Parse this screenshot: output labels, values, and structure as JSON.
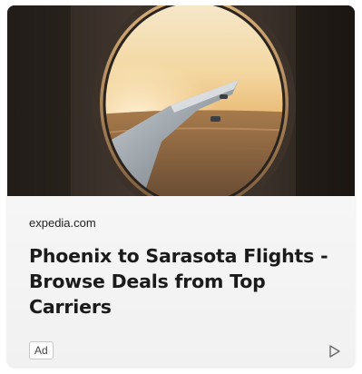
{
  "ad": {
    "image_alt": "airplane wing seen through window at sunset",
    "source": "expedia.com",
    "headline": "Phoenix to Sarasota Flights - Browse Deals from Top Carriers",
    "badge": "Ad",
    "adchoices_icon": "adchoices-play-icon"
  },
  "colors": {
    "card_bg": "#f3f3f3",
    "headline": "#1b1b1b",
    "source": "#222222",
    "badge_border": "#c8c8c8"
  }
}
